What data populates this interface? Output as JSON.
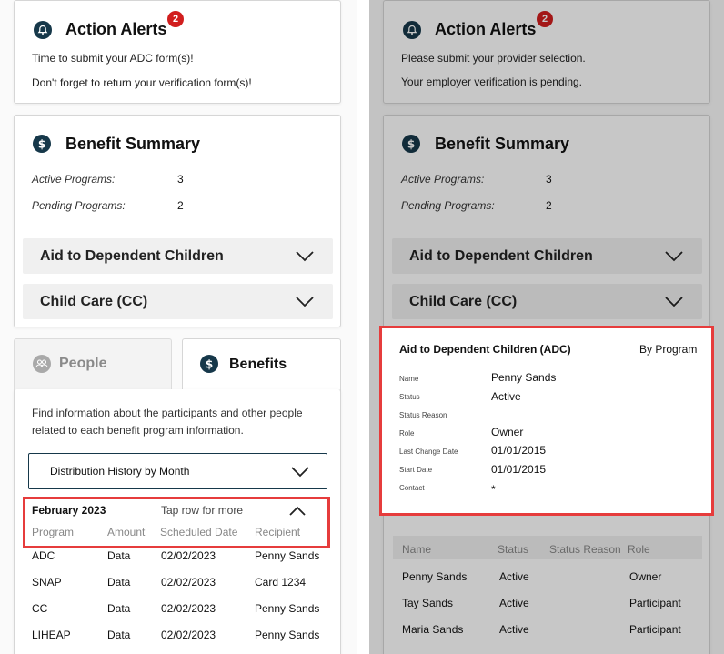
{
  "left": {
    "alerts": {
      "title": "Action Alerts",
      "badge": "2",
      "lines": [
        "Time to submit your ADC form(s)!",
        "Don't forget to return your verification form(s)!"
      ]
    },
    "summary": {
      "title": "Benefit Summary",
      "active_label": "Active Programs:",
      "active_value": "3",
      "pending_label": "Pending Programs:",
      "pending_value": "2",
      "accordions": [
        "Aid to Dependent Children",
        "Child Care (CC)"
      ]
    },
    "tabs": {
      "people": "People",
      "benefits": "Benefits"
    },
    "benefits": {
      "intro": "Find information about the participants and other people related to each benefit program information.",
      "dropdown_value": "Distribution History by Month",
      "month": "February 2023",
      "hint": "Tap row for more",
      "columns": [
        "Program",
        "Amount",
        "Scheduled Date",
        "Recipient"
      ],
      "rows": [
        [
          "ADC",
          "Data",
          "02/02/2023",
          "Penny Sands"
        ],
        [
          "SNAP",
          "Data",
          "02/02/2023",
          "Card 1234"
        ],
        [
          "CC",
          "Data",
          "02/02/2023",
          "Penny Sands"
        ],
        [
          "LIHEAP",
          "Data",
          "02/02/2023",
          "Penny Sands"
        ]
      ]
    }
  },
  "right": {
    "alerts": {
      "title": "Action Alerts",
      "badge": "2",
      "lines": [
        "Please submit your provider selection.",
        "Your employer verification is pending."
      ]
    },
    "summary": {
      "title": "Benefit Summary",
      "active_label": "Active Programs:",
      "active_value": "3",
      "pending_label": "Pending Programs:",
      "pending_value": "2",
      "accordions": [
        "Aid to Dependent Children",
        "Child Care (CC)"
      ]
    },
    "people": {
      "columns": [
        "Name",
        "Status",
        "Status Reason",
        "Role"
      ],
      "rows": [
        [
          "Penny Sands",
          "Active",
          "",
          "Owner"
        ],
        [
          "Tay Sands",
          "Active",
          "",
          "Participant"
        ],
        [
          "Maria Sands",
          "Active",
          "",
          "Participant"
        ]
      ]
    },
    "detail": {
      "title": "Aid to Dependent Children (ADC)",
      "link": "By Program",
      "fields": [
        {
          "label": "Name",
          "value": "Penny Sands"
        },
        {
          "label": "Status",
          "value": "Active"
        },
        {
          "label": "Status Reason",
          "value": ""
        },
        {
          "label": "Role",
          "value": "Owner"
        },
        {
          "label": "Last Change Date",
          "value": "01/01/2015"
        },
        {
          "label": "Start Date",
          "value": "01/01/2015"
        },
        {
          "label": "Contact",
          "value": "*"
        }
      ]
    }
  },
  "colors": {
    "icon": "#16384a",
    "badge": "#d11e1e",
    "highlight": "#e63c3c"
  },
  "icons": [
    "bell-icon",
    "dollar-icon",
    "people-icon",
    "chevron-down-icon",
    "chevron-up-icon"
  ]
}
